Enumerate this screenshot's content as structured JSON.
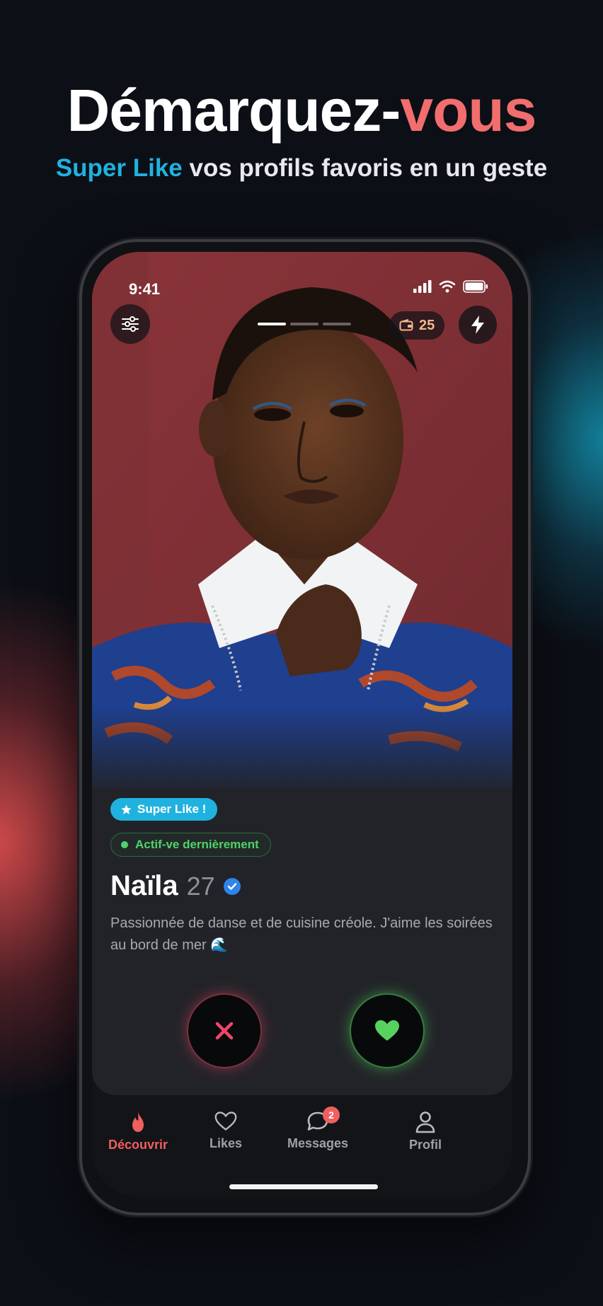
{
  "headline": {
    "part1": "Démarquez-",
    "part2": "vous"
  },
  "subline": {
    "accent": "Super Like",
    "rest": " vos profils favoris en un geste"
  },
  "status_bar": {
    "time": "9:41"
  },
  "top_bar": {
    "credits": "25"
  },
  "photo_progress": {
    "total": 3,
    "active": 1
  },
  "profile": {
    "super_like_badge": "Super Like !",
    "activity_badge": "Actif-ve dernièrement",
    "name": "Naïla",
    "age": "27",
    "bio": "Passionnée de danse et de cuisine créole. J'aime les soirées au bord de mer 🌊"
  },
  "tabs": [
    {
      "label": "Découvrir",
      "icon": "flame-icon",
      "active": true
    },
    {
      "label": "Likes",
      "icon": "heart-outline-icon",
      "active": false
    },
    {
      "label": "Messages",
      "icon": "chat-icon",
      "active": false,
      "badge": "2"
    },
    {
      "label": "Profil",
      "icon": "person-icon",
      "active": false
    }
  ],
  "colors": {
    "accent_red": "#f26d6d",
    "accent_blue": "#1fb2df",
    "active_green": "#4fd36a",
    "nope_pink": "#f0466a",
    "like_green": "#50dc5a"
  }
}
